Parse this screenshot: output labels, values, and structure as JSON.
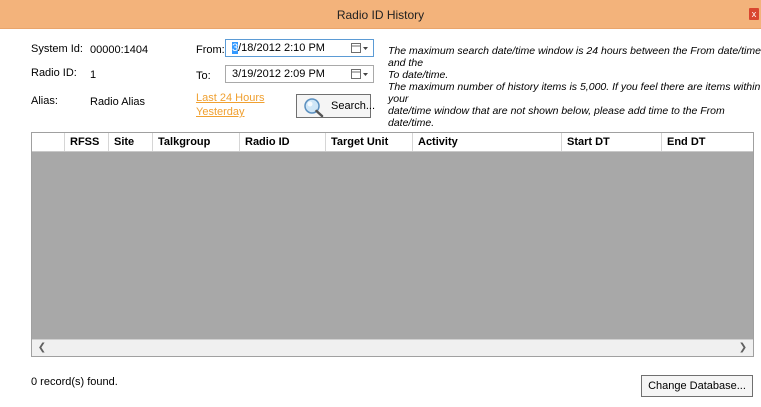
{
  "window": {
    "title": "Radio ID History",
    "close_label": "x"
  },
  "fields": {
    "system_id_label": "System Id:",
    "system_id_value": "00000:1404",
    "radio_id_label": "Radio ID:",
    "radio_id_value": "1",
    "alias_label": "Alias:",
    "alias_value": "Radio Alias"
  },
  "range": {
    "from_label": "From:",
    "from_selected": "3",
    "from_rest": "/18/2012  2:10 PM",
    "to_label": "To:",
    "to_value": "3/19/2012  2:09 PM",
    "last24_link": "Last 24 Hours",
    "yesterday_link": "Yesterday",
    "search_label": "Search..."
  },
  "info": {
    "line1": "The maximum search date/time window is 24 hours between the From date/time and the",
    "line2": "To date/time.",
    "line3": "The maximum number of history items is 5,000.  If you feel there are items within your",
    "line4": "date/time window that are not shown below, please add time to the From date/time."
  },
  "grid": {
    "columns": [
      "RFSS",
      "Site",
      "Talkgroup",
      "Radio ID",
      "Target Unit",
      "Activity",
      "Start DT",
      "End DT"
    ],
    "rows": []
  },
  "footer": {
    "record_count": "0 record(s) found.",
    "change_db_label": "Change Database..."
  },
  "colors": {
    "titlebar": "#f3b37b",
    "link": "#f0a030",
    "grid_background": "#a8a8a8",
    "selection": "#3399ff"
  }
}
